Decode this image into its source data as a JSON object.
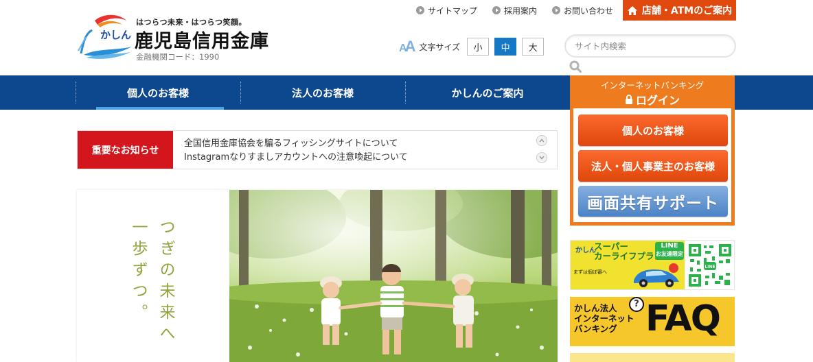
{
  "header": {
    "logo": {
      "tagline": "はつらつ未来・はつらつ笑顔。",
      "kashin_mark": "かしん",
      "name": "鹿児島信用金庫",
      "code": "金融機関コード：1990"
    },
    "util_links": [
      {
        "label": "サイトマップ"
      },
      {
        "label": "採用案内"
      },
      {
        "label": "お問い合わせ"
      }
    ],
    "store_button": {
      "label": "店舗・ATMのご案内",
      "icon": "home-icon",
      "color": "#e04a0e"
    },
    "font_size": {
      "label": "文字サイズ",
      "options": [
        "小",
        "中",
        "大"
      ],
      "selected": "中"
    },
    "search": {
      "placeholder": "サイト内検索",
      "value": ""
    }
  },
  "global_nav": {
    "items": [
      {
        "label": "個人のお客様",
        "active": true
      },
      {
        "label": "法人のお客様",
        "active": false
      },
      {
        "label": "かしんのご案内",
        "active": false
      }
    ],
    "color": "#0d478d"
  },
  "login_panel": {
    "subtitle": "インターネットバンキング",
    "title": "ログイン",
    "buttons": [
      {
        "label": "個人のお客様"
      },
      {
        "label": "法人・個人事業主のお客様"
      },
      {
        "label": "画面共有サポート"
      }
    ],
    "color": "#ee7b1e"
  },
  "news": {
    "label": "重要なお知らせ",
    "items": [
      "全国信用金庫協会を騙るフィッシングサイトについて",
      "Instagramなりすましアカウントへの注意喚起について"
    ]
  },
  "hero": {
    "lines": [
      "つぎの未来へ",
      "一歩ずつ。"
    ]
  },
  "banners": {
    "line": {
      "kashin": "かしん",
      "title_line1": "スーパー",
      "title_line2": "カーライフプラン",
      "line_badge_1": "LINE",
      "line_badge_2": "お友達限定",
      "line_badge_3": "金利優遇",
      "note": "まずは個ぼ審へ",
      "qr_label": "LINE"
    },
    "faq": {
      "line1": "かしん法人",
      "line2": "インターネット",
      "line3": "バンキング",
      "faq": "FAQ",
      "question_mark": "?"
    }
  }
}
